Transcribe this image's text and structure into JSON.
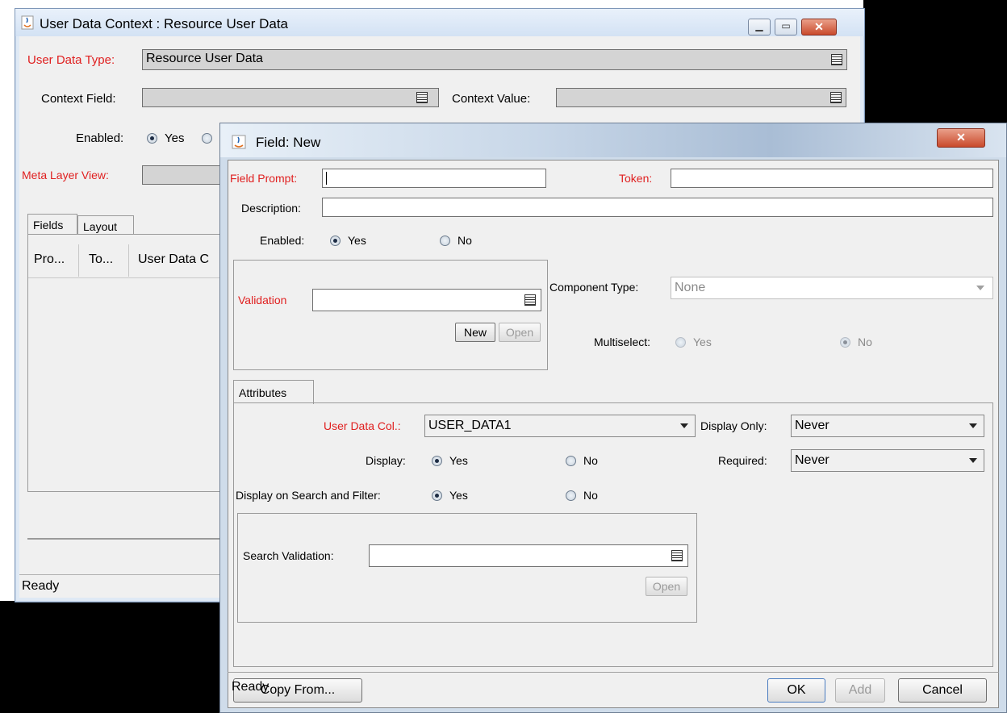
{
  "back_window": {
    "title": "User Data Context : Resource User Data",
    "user_data_type_label": "User Data Type:",
    "user_data_type_value": "Resource User Data",
    "context_field_label": "Context Field:",
    "context_value_label": "Context Value:",
    "enabled_label": "Enabled:",
    "enabled_yes": "Yes",
    "meta_layer_label": "Meta Layer View:",
    "tabs": [
      "Fields",
      "Layout"
    ],
    "columns": [
      "Pro...",
      "To...",
      "User Data C"
    ],
    "status": "Ready"
  },
  "front_window": {
    "title": "Field: New",
    "field_prompt_label": "Field Prompt:",
    "token_label": "Token:",
    "description_label": "Description:",
    "enabled_label": "Enabled:",
    "enabled_yes": "Yes",
    "enabled_no": "No",
    "validation_label": "Validation",
    "new_button": "New",
    "open_button": "Open",
    "component_type_label": "Component Type:",
    "component_type_value": "None",
    "multiselect_label": "Multiselect:",
    "multiselect_yes": "Yes",
    "multiselect_no": "No",
    "attributes_tab": "Attributes",
    "user_data_col_label": "User Data Col.:",
    "user_data_col_value": "USER_DATA1",
    "display_only_label": "Display Only:",
    "display_only_value": "Never",
    "display_label": "Display:",
    "display_yes": "Yes",
    "display_no": "No",
    "required_label": "Required:",
    "required_value": "Never",
    "display_search_label": "Display on Search and Filter:",
    "display_search_yes": "Yes",
    "display_search_no": "No",
    "search_validation_label": "Search Validation:",
    "search_open_button": "Open",
    "copy_from_button": "Copy From...",
    "ok_button": "OK",
    "add_button": "Add",
    "cancel_button": "Cancel",
    "status": "Ready"
  }
}
